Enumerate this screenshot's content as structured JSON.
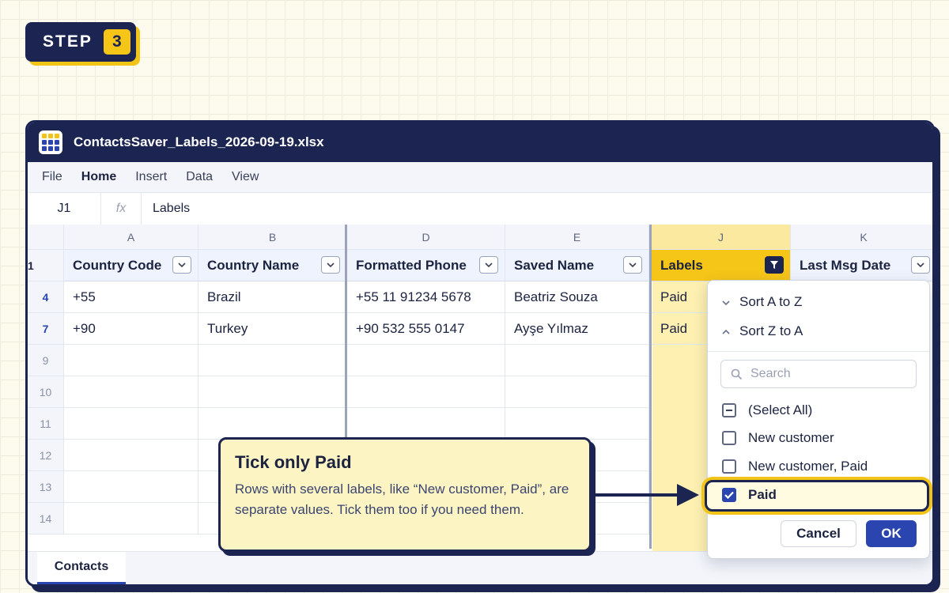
{
  "step": {
    "label": "STEP",
    "number": "3"
  },
  "window": {
    "title": "ContactsSaver_Labels_2026-09-19.xlsx"
  },
  "menu": [
    "File",
    "Home",
    "Insert",
    "Data",
    "View"
  ],
  "formula": {
    "cell": "J1",
    "fx": "fx",
    "value": "Labels"
  },
  "columns": [
    {
      "letter": "A",
      "header": "Country Code"
    },
    {
      "letter": "B",
      "header": "Country Name"
    },
    {
      "letter": "D",
      "header": "Formatted Phone"
    },
    {
      "letter": "E",
      "header": "Saved Name"
    },
    {
      "letter": "J",
      "header": "Labels"
    },
    {
      "letter": "K",
      "header": "Last Msg Date"
    }
  ],
  "header_row_number": "1",
  "rows": [
    {
      "num": "4",
      "cells": [
        "+55",
        "Brazil",
        "+55 11 91234 5678",
        "Beatriz Souza",
        "Paid",
        ""
      ]
    },
    {
      "num": "7",
      "cells": [
        "+90",
        "Turkey",
        "+90 532 555 0147",
        "Ayşe Yılmaz",
        "Paid",
        ""
      ]
    },
    {
      "num": "9"
    },
    {
      "num": "10"
    },
    {
      "num": "11"
    },
    {
      "num": "12"
    },
    {
      "num": "13"
    },
    {
      "num": "14"
    }
  ],
  "sheet_tab": "Contacts",
  "filter_menu": {
    "sort_asc": "Sort A to Z",
    "sort_desc": "Sort Z to A",
    "search_placeholder": "Search",
    "options": [
      {
        "label": "(Select All)",
        "state": "indeterminate"
      },
      {
        "label": "New customer",
        "state": "unchecked"
      },
      {
        "label": "New customer, Paid",
        "state": "unchecked"
      },
      {
        "label": "Paid",
        "state": "checked"
      }
    ],
    "cancel": "Cancel",
    "ok": "OK"
  },
  "callout": {
    "title": "Tick only Paid",
    "body": "Rows with several labels, like “New customer, Paid”, are separate values. Tick them too if you need them."
  },
  "colors": {
    "navy": "#1c2552",
    "accent": "#f2c418",
    "blue": "#2a45b0",
    "highlight": "#fdf0b0"
  }
}
